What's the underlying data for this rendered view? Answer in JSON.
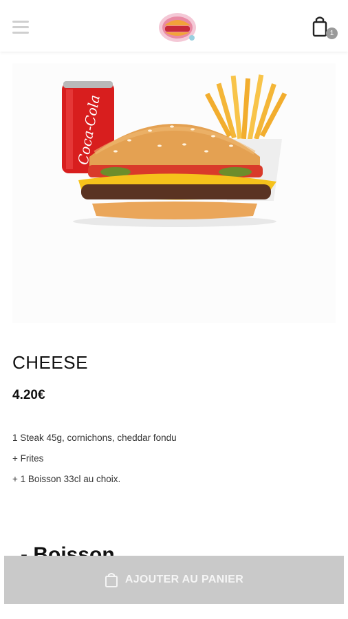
{
  "header": {
    "menu_icon": "hamburger-menu-icon",
    "logo": "restaurant-logo",
    "cart_icon": "shopping-bag-icon",
    "cart_count": "1"
  },
  "product": {
    "image": "cheeseburger-menu-photo",
    "name": "CHEESE",
    "price": "4.20€",
    "description": [
      "1 Steak 45g, cornichons, cheddar fondu",
      "+ Frites",
      "+ 1 Boisson 33cl au choix."
    ],
    "drink_can_text": "Coca-Cola"
  },
  "options": {
    "section_title": "- Boisson"
  },
  "footer": {
    "add_to_cart_label": "AJOUTER AU PANIER"
  },
  "colors": {
    "button_bg": "#c9c9c9",
    "can_red": "#d81e1e",
    "bun": "#e4a152",
    "cheese": "#f6c21b"
  }
}
